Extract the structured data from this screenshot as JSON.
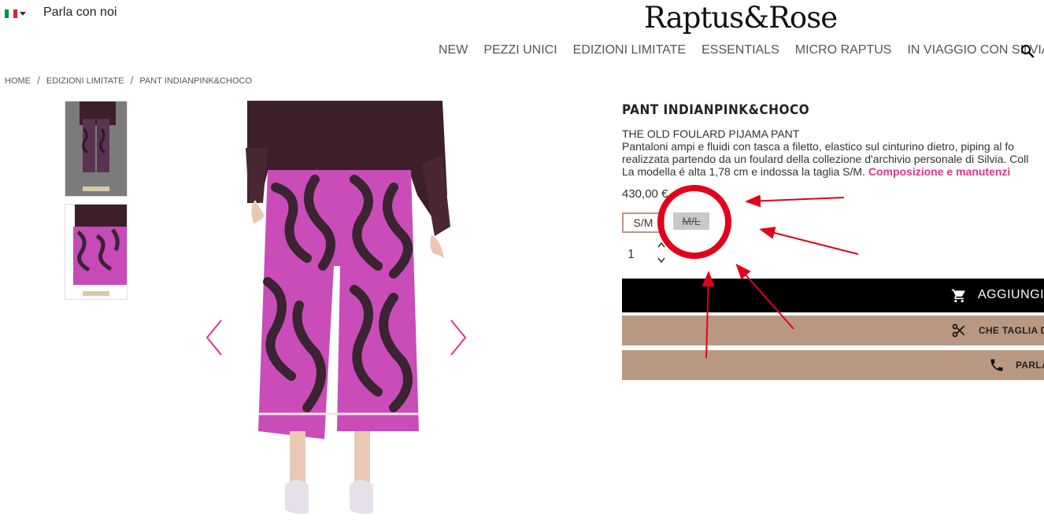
{
  "topbar": {
    "flag_icon": "italy-flag-icon",
    "contact_label": "Parla con noi"
  },
  "brand": {
    "logo_text": "Raptus&Rose"
  },
  "nav": {
    "items": [
      {
        "label": "NEW"
      },
      {
        "label": "PEZZI UNICI"
      },
      {
        "label": "EDIZIONI LIMITATE"
      },
      {
        "label": "ESSENTIALS"
      },
      {
        "label": "MICRO RAPTUS"
      },
      {
        "label": "IN VIAGGIO CON SILVIA"
      }
    ],
    "search_icon": "search-icon"
  },
  "breadcrumb": {
    "items": [
      {
        "label": "HOME"
      },
      {
        "label": "EDIZIONI LIMITATE"
      },
      {
        "label": "PANT INDIANPINK&CHOCO"
      }
    ],
    "separator": "/"
  },
  "product": {
    "title": "PANT INDIANPINK&CHOCO",
    "subtitle": "THE OLD FOULARD PIJAMA PANT",
    "desc_line1": "Pantaloni ampi e fluidi con tasca a filetto, elastico sul cinturino dietro, piping al fo",
    "desc_line2": "realizzata partendo da un foulard della collezione d'archivio personale di Silvia. Coll",
    "desc_line3": "La modella é alta 1,78 cm e indossa la taglia S/M.",
    "composition_link": "Composizione e manutenzi",
    "price": "430,00 €",
    "sizes": [
      {
        "label": "S/M",
        "available": true
      },
      {
        "label": "M/L",
        "available": false
      }
    ],
    "quantity": "1"
  },
  "actions": {
    "add_to_cart": "AGGIUNGI",
    "size_help": "CHE TAGLIA D",
    "talk": "PARLA"
  },
  "colors": {
    "accent_pink": "#e0338f",
    "button_tan": "#b99883",
    "annotation_red": "#e3001b"
  }
}
